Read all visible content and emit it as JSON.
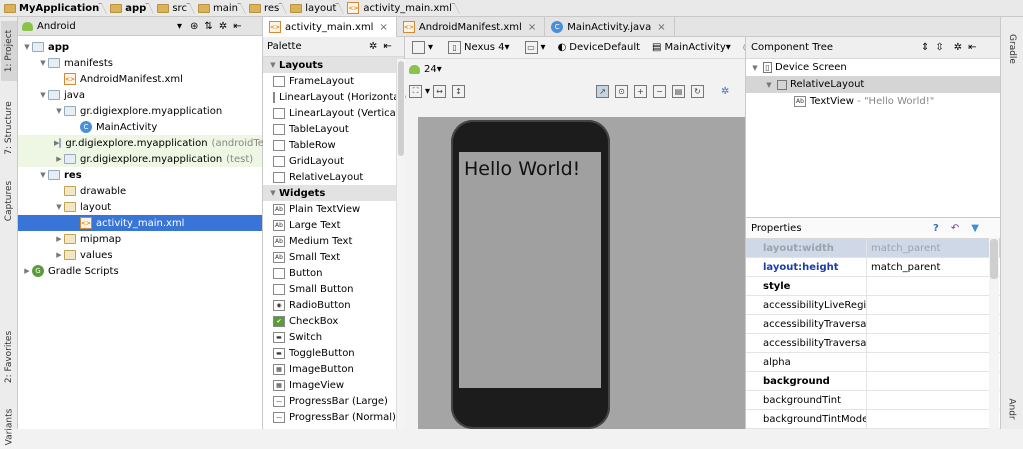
{
  "breadcrumb": [
    "MyApplication",
    "app",
    "src",
    "main",
    "res",
    "layout",
    "activity_main.xml"
  ],
  "left_strip": {
    "project": "1: Project",
    "structure": "7: Structure",
    "captures": "Captures",
    "favorites": "2: Favorites",
    "variants": "Variants"
  },
  "right_strip": {
    "gradle": "Gradle",
    "android": "Andr"
  },
  "project": {
    "view_mode": "Android",
    "rows": [
      {
        "label": "app",
        "icon": "folder",
        "arrow": "▼"
      },
      {
        "label": "manifests",
        "icon": "folder",
        "arrow": "▼"
      },
      {
        "label": "AndroidManifest.xml",
        "icon": "xml",
        "arrow": ""
      },
      {
        "label": "java",
        "icon": "folder",
        "arrow": "▼"
      },
      {
        "label": "gr.digiexplore.myapplication",
        "icon": "folder",
        "arrow": "▼",
        "suffix": ""
      },
      {
        "label": "MainActivity",
        "icon": "class",
        "arrow": ""
      },
      {
        "label": "gr.digiexplore.myapplication",
        "icon": "folder",
        "arrow": "▶",
        "suffix": "(androidTest)"
      },
      {
        "label": "gr.digiexplore.myapplication",
        "icon": "folder",
        "arrow": "▶",
        "suffix": "(test)"
      },
      {
        "label": "res",
        "icon": "folder",
        "arrow": "▼"
      },
      {
        "label": "drawable",
        "icon": "res",
        "arrow": ""
      },
      {
        "label": "layout",
        "icon": "res",
        "arrow": "▼"
      },
      {
        "label": "activity_main.xml",
        "icon": "xml",
        "arrow": ""
      },
      {
        "label": "mipmap",
        "icon": "res",
        "arrow": "▶"
      },
      {
        "label": "values",
        "icon": "res",
        "arrow": "▶"
      },
      {
        "label": "Gradle Scripts",
        "icon": "gradle",
        "arrow": "▶"
      }
    ]
  },
  "tabs": [
    {
      "label": "activity_main.xml",
      "close": "×"
    },
    {
      "label": "AndroidManifest.xml",
      "close": "×"
    },
    {
      "label": "MainActivity.java",
      "close": "×"
    }
  ],
  "palette": {
    "title": "Palette",
    "items": [
      {
        "t": "cat",
        "label": "Layouts"
      },
      {
        "t": "i",
        "label": "FrameLayout"
      },
      {
        "t": "i",
        "label": "LinearLayout (Horizontal)"
      },
      {
        "t": "i",
        "label": "LinearLayout (Vertical)"
      },
      {
        "t": "i",
        "label": "TableLayout"
      },
      {
        "t": "i",
        "label": "TableRow"
      },
      {
        "t": "i",
        "label": "GridLayout"
      },
      {
        "t": "i",
        "label": "RelativeLayout"
      },
      {
        "t": "cat",
        "label": "Widgets"
      },
      {
        "t": "i",
        "label": "Plain TextView"
      },
      {
        "t": "i",
        "label": "Large Text"
      },
      {
        "t": "i",
        "label": "Medium Text"
      },
      {
        "t": "i",
        "label": "Small Text"
      },
      {
        "t": "i",
        "label": "Button"
      },
      {
        "t": "i",
        "label": "Small Button"
      },
      {
        "t": "i",
        "label": "RadioButton"
      },
      {
        "t": "i",
        "label": "CheckBox"
      },
      {
        "t": "i",
        "label": "Switch"
      },
      {
        "t": "i",
        "label": "ToggleButton"
      },
      {
        "t": "i",
        "label": "ImageButton"
      },
      {
        "t": "i",
        "label": "ImageView"
      },
      {
        "t": "i",
        "label": "ProgressBar (Large)"
      },
      {
        "t": "i",
        "label": "ProgressBar (Normal)"
      }
    ]
  },
  "designer": {
    "device": "Nexus 4",
    "theme": "DeviceDefault",
    "activity": "MainActivity",
    "api": "24",
    "hello": "Hello World!"
  },
  "component_tree": {
    "title": "Component Tree",
    "device": "Device Screen",
    "layout": "RelativeLayout",
    "textview": "TextView",
    "textview_value": "- \"Hello World!\""
  },
  "properties": {
    "title": "Properties",
    "rows": [
      {
        "k": "layout:width",
        "v": "match_parent",
        "style": "hl"
      },
      {
        "k": "layout:height",
        "v": "match_parent",
        "style": "blue"
      },
      {
        "k": "style",
        "v": "",
        "style": "bold"
      },
      {
        "k": "accessibilityLiveRegion",
        "v": "",
        "style": ""
      },
      {
        "k": "accessibilityTraversalAfte",
        "v": "",
        "style": ""
      },
      {
        "k": "accessibilityTraversalBefc",
        "v": "",
        "style": ""
      },
      {
        "k": "alpha",
        "v": "",
        "style": ""
      },
      {
        "k": "background",
        "v": "",
        "style": "bold"
      },
      {
        "k": "backgroundTint",
        "v": "",
        "style": ""
      },
      {
        "k": "backgroundTintMode",
        "v": "",
        "style": ""
      }
    ]
  }
}
